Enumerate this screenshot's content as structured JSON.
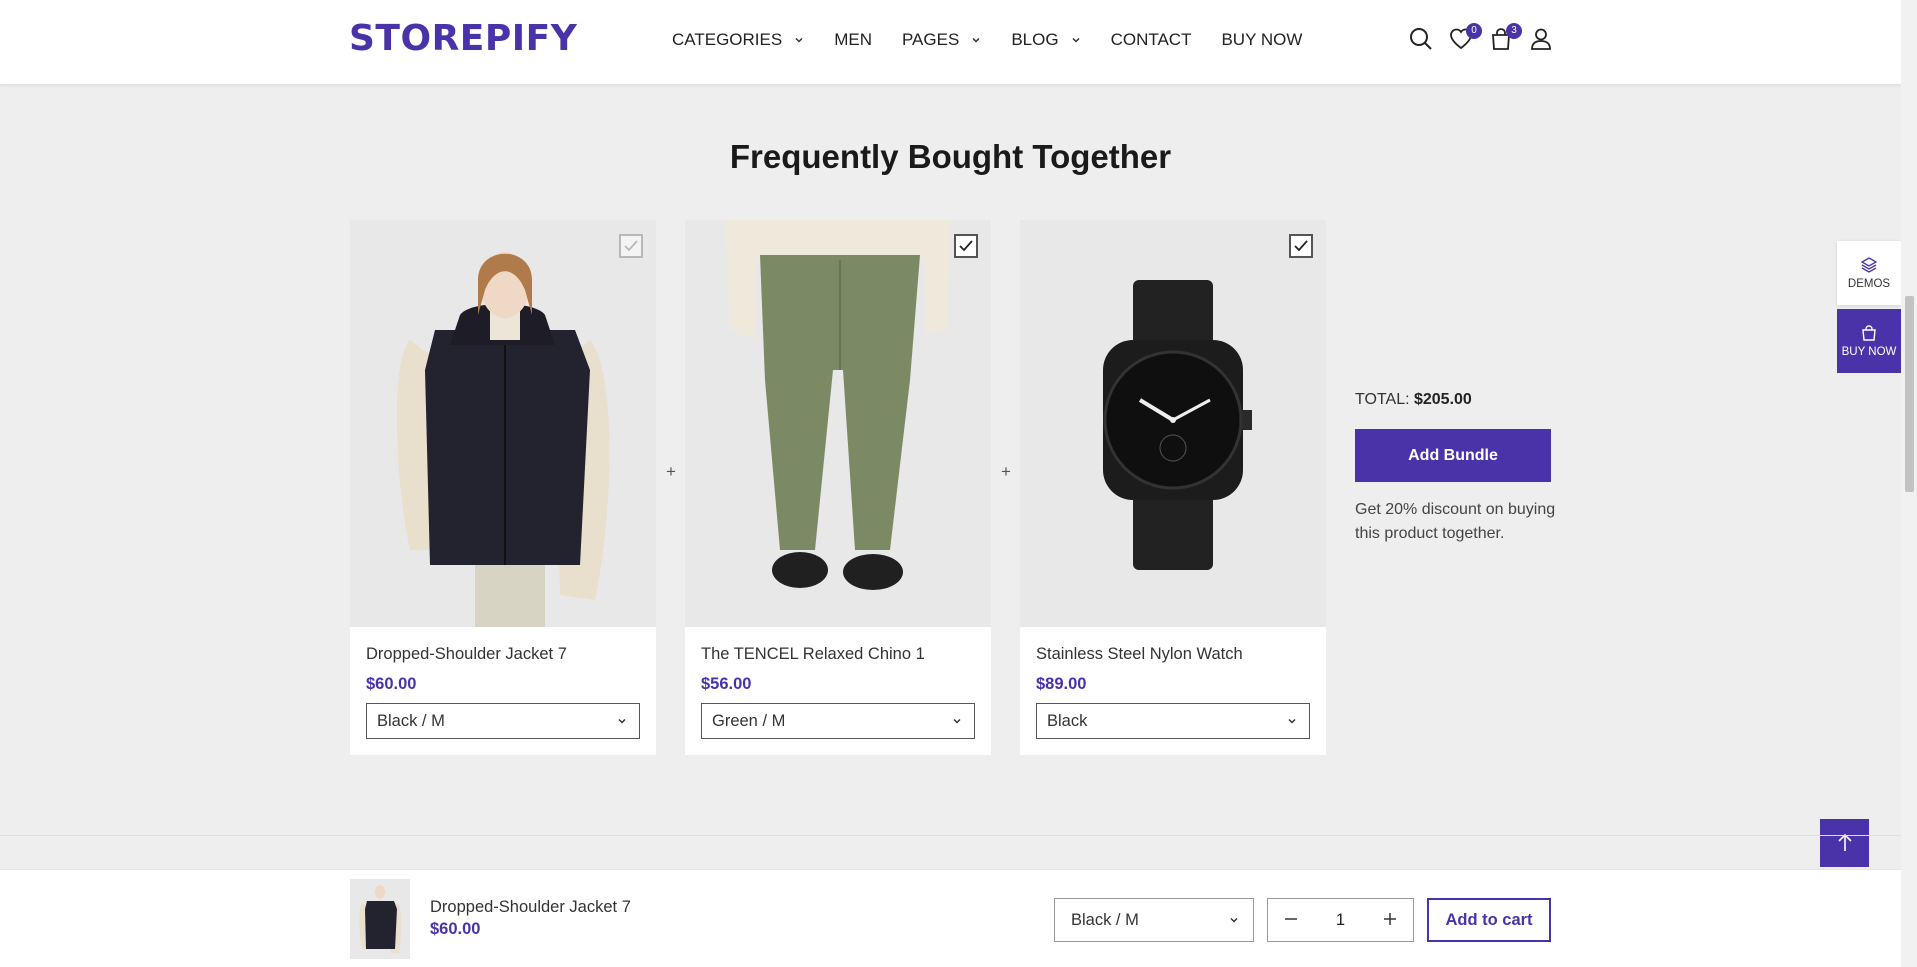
{
  "brand": {
    "logo": "STOREPIFY",
    "accent": "#4a33a8"
  },
  "nav": {
    "items": [
      {
        "label": "CATEGORIES",
        "dropdown": true
      },
      {
        "label": "MEN",
        "dropdown": false
      },
      {
        "label": "PAGES",
        "dropdown": true
      },
      {
        "label": "BLOG",
        "dropdown": true
      },
      {
        "label": "CONTACT",
        "dropdown": false
      },
      {
        "label": "BUY NOW",
        "dropdown": false
      }
    ]
  },
  "header_icons": {
    "wishlist_count": "0",
    "cart_count": "3",
    "icons": [
      "search-icon",
      "heart-icon",
      "bag-icon",
      "user-icon"
    ]
  },
  "section": {
    "title": "Frequently Bought Together",
    "products": [
      {
        "name": "Dropped-Shoulder Jacket 7",
        "price": "$60.00",
        "variant": "Black / M",
        "checked": false
      },
      {
        "name": "The TENCEL Relaxed Chino 1",
        "price": "$56.00",
        "variant": "Green / M",
        "checked": true
      },
      {
        "name": "Stainless Steel Nylon Watch",
        "price": "$89.00",
        "variant": "Black",
        "checked": true
      }
    ],
    "plus": "+",
    "total_label": "TOTAL:",
    "total_value": "$205.00",
    "bundle_button": "Add Bundle",
    "note": "Get 20% discount on buying this product together."
  },
  "side": {
    "demos": "DEMOS",
    "buy_now": "BUY NOW"
  },
  "sticky": {
    "name": "Dropped-Shoulder Jacket 7",
    "price": "$60.00",
    "variant": "Black / M",
    "quantity": "1",
    "add_to_cart": "Add to cart"
  }
}
